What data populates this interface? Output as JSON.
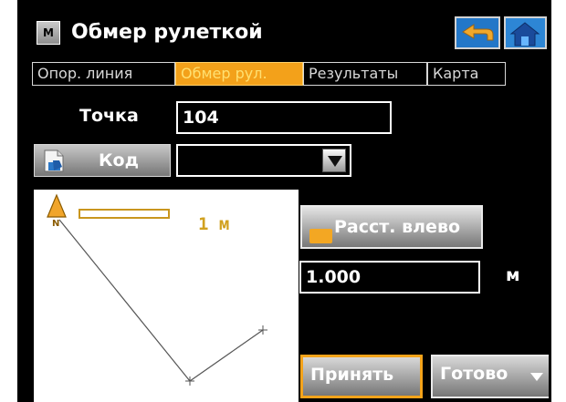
{
  "window": {
    "title": "Обмер рулеткой",
    "app_icon_letter": "M"
  },
  "tabs": [
    {
      "label": "Опор. линия",
      "active": false
    },
    {
      "label": "Обмер рул.",
      "active": true
    },
    {
      "label": "Результаты",
      "active": false
    },
    {
      "label": "Карта",
      "active": false
    }
  ],
  "form": {
    "point_label": "Точка",
    "point_value": "104",
    "code_button_label": "Код",
    "code_value": "",
    "distance_button_label": "Расст. влево",
    "distance_value": "1.000",
    "distance_unit": "м"
  },
  "map": {
    "scale_label": "1 м",
    "marker_icon": "north-arrow-icon",
    "line_color": "#555555",
    "scale_color": "#d1a11f"
  },
  "actions": {
    "accept_label": "Принять",
    "done_label": "Готово"
  },
  "colors": {
    "accent": "#f3a11a",
    "background": "#000000",
    "text": "#ffffff"
  }
}
